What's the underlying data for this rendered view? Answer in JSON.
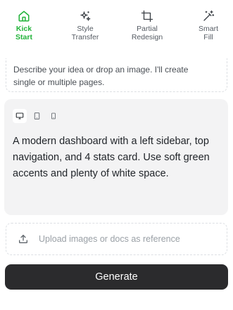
{
  "tabs": [
    {
      "line1": "Kick",
      "line2": "Start",
      "icon": "home-icon",
      "active": true
    },
    {
      "line1": "Style",
      "line2": "Transfer",
      "icon": "sparkles-icon",
      "active": false
    },
    {
      "line1": "Partial",
      "line2": "Redesign",
      "icon": "crop-icon",
      "active": false
    },
    {
      "line1": "Smart",
      "line2": "Fill",
      "icon": "magic-wand-icon",
      "active": false
    }
  ],
  "description": {
    "line1": "Describe your idea or drop an image. I'll create",
    "line2": "single or multiple pages."
  },
  "device_toggle": {
    "options": [
      "desktop",
      "tablet",
      "mobile"
    ],
    "selected": "desktop"
  },
  "prompt": {
    "text": "A modern dashboard with a left sidebar, top navigation, and 4 stats card. Use soft green accents and plenty of white space."
  },
  "upload": {
    "label": "Upload images or docs as reference",
    "icon": "upload-icon"
  },
  "generate": {
    "label": "Generate"
  },
  "colors": {
    "accent": "#22b33a",
    "button_bg": "#2b2b2d",
    "card_bg": "#f3f3f4",
    "muted_text": "#9aa0a6"
  }
}
